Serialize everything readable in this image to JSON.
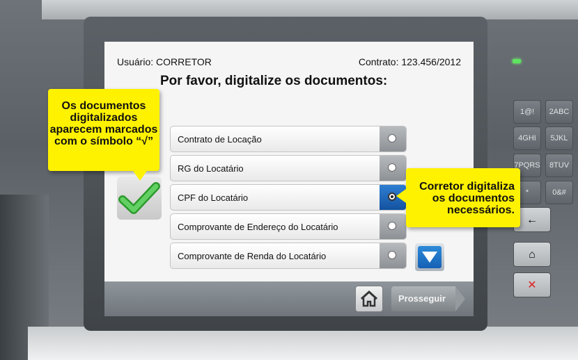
{
  "screen": {
    "user_label": "Usuário: CORRETOR",
    "contract_label": "Contrato: 123.456/2012",
    "title": "Por favor, digitalize os documentos:",
    "documents": [
      {
        "label": "Contrato de Locação",
        "selected": false
      },
      {
        "label": "RG do Locatário",
        "selected": false
      },
      {
        "label": "CPF do Locatário",
        "selected": true
      },
      {
        "label": "Comprovante de Endereço do Locatário",
        "selected": false
      },
      {
        "label": "Comprovante de Renda do Locatário",
        "selected": false
      }
    ],
    "proceed_label": "Prosseguir",
    "home_icon": "home-icon",
    "scroll_icon": "arrow-down-icon"
  },
  "callouts": {
    "left_text": "Os documentos digitalizados aparecem marcados com o símbolo “√”",
    "right_text": "Corretor digitaliza os documentos necessários."
  },
  "keypad": {
    "keys": [
      {
        "label": "1@!"
      },
      {
        "label": "2ABC"
      },
      {
        "label": "4GHI"
      },
      {
        "label": "5JKL"
      },
      {
        "label": "7PQRS"
      },
      {
        "label": "8TUV"
      },
      {
        "label": "*"
      },
      {
        "label": "0&#"
      }
    ]
  },
  "colors": {
    "callout": "#fff200",
    "selected_radio": "#1f6ec2",
    "check": "#3cb43c",
    "led": "#5fe35f"
  }
}
